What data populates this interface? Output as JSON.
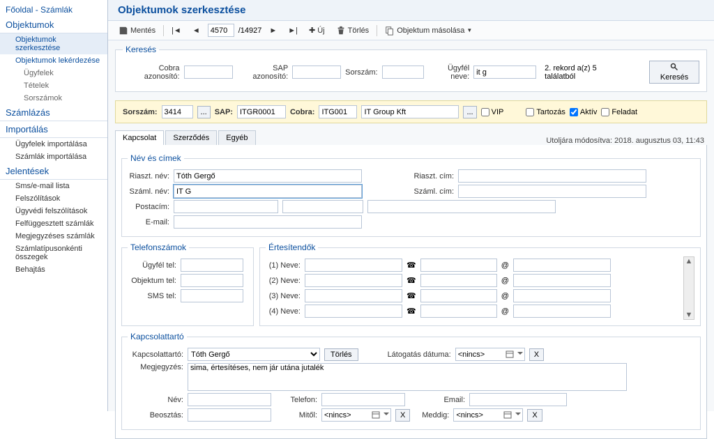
{
  "breadcrumb": "Főoldal - Számlák",
  "sidebar": {
    "s1": {
      "title": "Objektumok",
      "items": [
        "Objektumok szerkesztése",
        "Objektumok lekérdezése"
      ],
      "subs": [
        "Ügyfelek",
        "Tételek",
        "Sorszámok"
      ]
    },
    "s2": {
      "title": "Számlázás"
    },
    "s3": {
      "title": "Importálás",
      "items": [
        "Ügyfelek importálása",
        "Számlák importálása"
      ]
    },
    "s4": {
      "title": "Jelentések",
      "items": [
        "Sms/e-mail lista",
        "Felszólítások",
        "Ügyvédi felszólítások",
        "Felfüggesztett számlák",
        "Megjegyzéses számlák",
        "Számlatípusonkénti összegek",
        "Behajtás"
      ]
    }
  },
  "page_title": "Objektumok szerkesztése",
  "toolbar": {
    "save": "Mentés",
    "curr": "4570",
    "total": "/14927",
    "new": "Új",
    "del": "Törlés",
    "copy": "Objektum másolása"
  },
  "search": {
    "legend": "Keresés",
    "cobra_lbl": "Cobra azonosító:",
    "sap_lbl": "SAP azonosító:",
    "sor_lbl": "Sorszám:",
    "ugyfel_lbl": "Ügyfél neve:",
    "ugyfel_val": "it g",
    "result": "2. rekord a(z) 5 találatból",
    "btn": "Keresés"
  },
  "bar": {
    "sor_lbl": "Sorszám:",
    "sor_val": "3414",
    "dots": "...",
    "sap_lbl": "SAP:",
    "sap_val": "ITGR0001",
    "cobra_lbl": "Cobra:",
    "cobra_val": "ITG001",
    "name": "IT Group Kft",
    "vip": "VIP",
    "tartozas": "Tartozás",
    "aktiv": "Aktív",
    "feladat": "Feladat"
  },
  "tabs": [
    "Kapcsolat",
    "Szerződés",
    "Egyéb"
  ],
  "last_mod": "Utoljára módosítva: 2018. augusztus 03, 11:43",
  "nev": {
    "legend": "Név és címek",
    "riaszt_nev_lbl": "Riaszt. név:",
    "riaszt_nev": "Tóth Gergő",
    "szaml_nev_lbl": "Száml. név:",
    "szaml_nev": "IT G",
    "riaszt_cim_lbl": "Riaszt. cím:",
    "szaml_cim_lbl": "Száml. cím:",
    "posta_lbl": "Postacím:",
    "email_lbl": "E-mail:"
  },
  "tel": {
    "legend": "Telefonszámok",
    "ugyfel": "Ügyfél tel:",
    "obj": "Objektum tel:",
    "sms": "SMS tel:"
  },
  "ert": {
    "legend": "Értesítendők",
    "rows": [
      "(1) Neve:",
      "(2) Neve:",
      "(3) Neve:",
      "(4) Neve:"
    ]
  },
  "kapcs": {
    "legend": "Kapcsolattartó",
    "lbl": "Kapcsolattartó:",
    "val": "Tóth Gergő",
    "torles": "Törlés",
    "latog_lbl": "Látogatás dátuma:",
    "nincs": "<nincs>",
    "x": "X",
    "megj_lbl": "Megjegyzés:",
    "megj": "sima, értesítéses, nem jár utána jutalék",
    "nev_lbl": "Név:",
    "tel_lbl": "Telefon:",
    "email_lbl": "Email:",
    "beo_lbl": "Beosztás:",
    "mitol_lbl": "Mitől:",
    "meddig_lbl": "Meddig:"
  }
}
